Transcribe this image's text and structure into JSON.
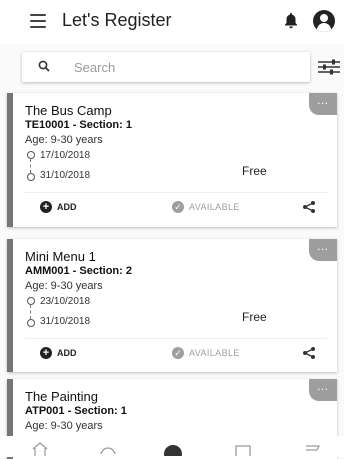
{
  "header": {
    "title": "Let's Register"
  },
  "search": {
    "placeholder": "Search"
  },
  "colors": {
    "accent": "#757575",
    "available": "#9e9e9e"
  },
  "cards": [
    {
      "title": "The Bus Camp",
      "code": "TE10001 - Section: 1",
      "age": "Age: 9-30 years",
      "start_date": "17/10/2018",
      "end_date": "31/10/2018",
      "price": "Free",
      "add_label": "ADD",
      "status": "AVAILABLE",
      "more": "…"
    },
    {
      "title": "Mini Menu 1",
      "code": "AMM001 - Section: 2",
      "age": "Age: 9-30 years",
      "start_date": "23/10/2018",
      "end_date": "31/10/2018",
      "price": "Free",
      "add_label": "ADD",
      "status": "AVAILABLE",
      "more": "…"
    },
    {
      "title": "The Painting",
      "code": "ATP001 - Section: 1",
      "age": "Age: 9-30 years",
      "more": "…"
    }
  ],
  "icons": {
    "menu": "menu-icon",
    "bell": "bell-icon",
    "avatar": "account-icon",
    "search": "search-icon",
    "filter": "filter-icon",
    "add": "plus-circle-icon",
    "available": "check-circle-icon",
    "share": "share-icon"
  }
}
